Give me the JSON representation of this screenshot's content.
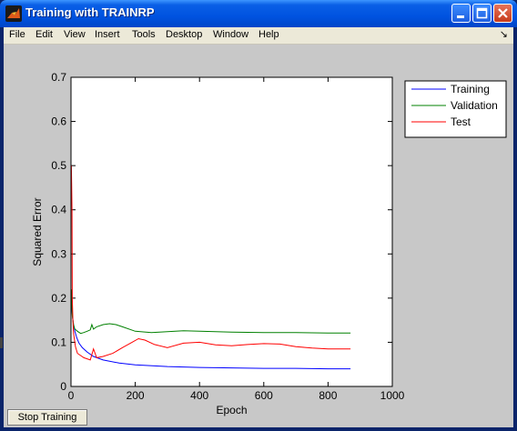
{
  "window": {
    "title": "Training with TRAINRP"
  },
  "menu": [
    "File",
    "Edit",
    "View",
    "Insert",
    "Tools",
    "Desktop",
    "Window",
    "Help"
  ],
  "stop_button": "Stop Training",
  "chart_data": {
    "type": "line",
    "xlabel": "Epoch",
    "ylabel": "Squared Error",
    "xlim": [
      0,
      1000
    ],
    "ylim": [
      0,
      0.7
    ],
    "x_ticks": [
      0,
      200,
      400,
      600,
      800,
      1000
    ],
    "y_ticks": [
      0,
      0.1,
      0.2,
      0.3,
      0.4,
      0.5,
      0.6,
      0.7
    ],
    "legend_position": "outside-right-top",
    "series": [
      {
        "name": "Training",
        "color": "#0000ff",
        "x": [
          1,
          3,
          5,
          8,
          12,
          18,
          25,
          35,
          50,
          70,
          100,
          150,
          200,
          300,
          400,
          500,
          600,
          700,
          800,
          870
        ],
        "y": [
          0.2,
          0.17,
          0.155,
          0.14,
          0.125,
          0.11,
          0.098,
          0.088,
          0.078,
          0.068,
          0.06,
          0.053,
          0.049,
          0.045,
          0.043,
          0.042,
          0.041,
          0.041,
          0.04,
          0.04
        ]
      },
      {
        "name": "Validation",
        "color": "#008000",
        "x": [
          1,
          4,
          8,
          12,
          20,
          30,
          40,
          50,
          60,
          65,
          70,
          80,
          100,
          120,
          140,
          160,
          200,
          250,
          300,
          350,
          400,
          500,
          600,
          700,
          800,
          870
        ],
        "y": [
          0.22,
          0.16,
          0.14,
          0.13,
          0.125,
          0.12,
          0.122,
          0.125,
          0.128,
          0.14,
          0.13,
          0.135,
          0.14,
          0.142,
          0.14,
          0.135,
          0.125,
          0.122,
          0.124,
          0.126,
          0.125,
          0.123,
          0.122,
          0.122,
          0.121,
          0.121
        ]
      },
      {
        "name": "Test",
        "color": "#ff0000",
        "x": [
          1,
          2,
          3,
          4,
          6,
          8,
          10,
          14,
          20,
          30,
          40,
          60,
          70,
          80,
          100,
          130,
          160,
          190,
          210,
          230,
          260,
          300,
          350,
          400,
          450,
          500,
          550,
          600,
          650,
          700,
          750,
          800,
          870
        ],
        "y": [
          0.5,
          0.46,
          0.4,
          0.2,
          0.15,
          0.12,
          0.11,
          0.09,
          0.075,
          0.07,
          0.065,
          0.06,
          0.085,
          0.065,
          0.068,
          0.075,
          0.088,
          0.1,
          0.108,
          0.105,
          0.095,
          0.088,
          0.098,
          0.1,
          0.094,
          0.092,
          0.095,
          0.097,
          0.096,
          0.09,
          0.087,
          0.085,
          0.085
        ]
      }
    ]
  }
}
